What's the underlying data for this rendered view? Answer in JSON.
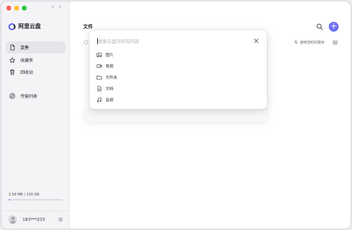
{
  "app": {
    "brand_name": "阿里云盘",
    "brand_color": "#5b5ff3",
    "back_arrow": "‹",
    "forward_arrow": "›"
  },
  "sidebar": {
    "items": [
      {
        "label": "文件",
        "icon": "file-icon",
        "active": true
      },
      {
        "label": "收藏夹",
        "icon": "star-icon",
        "active": false
      },
      {
        "label": "回收站",
        "icon": "trash-icon",
        "active": false
      },
      {
        "label": "传输列表",
        "icon": "transfer-icon",
        "active": false
      }
    ],
    "storage": {
      "label": "3.58 MB / 100 GB",
      "used_fraction": 0.02
    },
    "user": {
      "name": "183***233",
      "settings_icon": "gear-icon"
    }
  },
  "main": {
    "title": "文件",
    "sort_label": "按修改时间排序",
    "sort_icon": "⇅",
    "accent_color": "#6d6ef2",
    "add_label": "+"
  },
  "search_popup": {
    "placeholder": "搜索云盘内所有内容",
    "value": "",
    "filters": [
      {
        "label": "图片",
        "icon": "image-icon"
      },
      {
        "label": "视频",
        "icon": "video-icon"
      },
      {
        "label": "文件夹",
        "icon": "folder-icon"
      },
      {
        "label": "文档",
        "icon": "document-icon"
      },
      {
        "label": "音频",
        "icon": "music-icon"
      }
    ]
  }
}
